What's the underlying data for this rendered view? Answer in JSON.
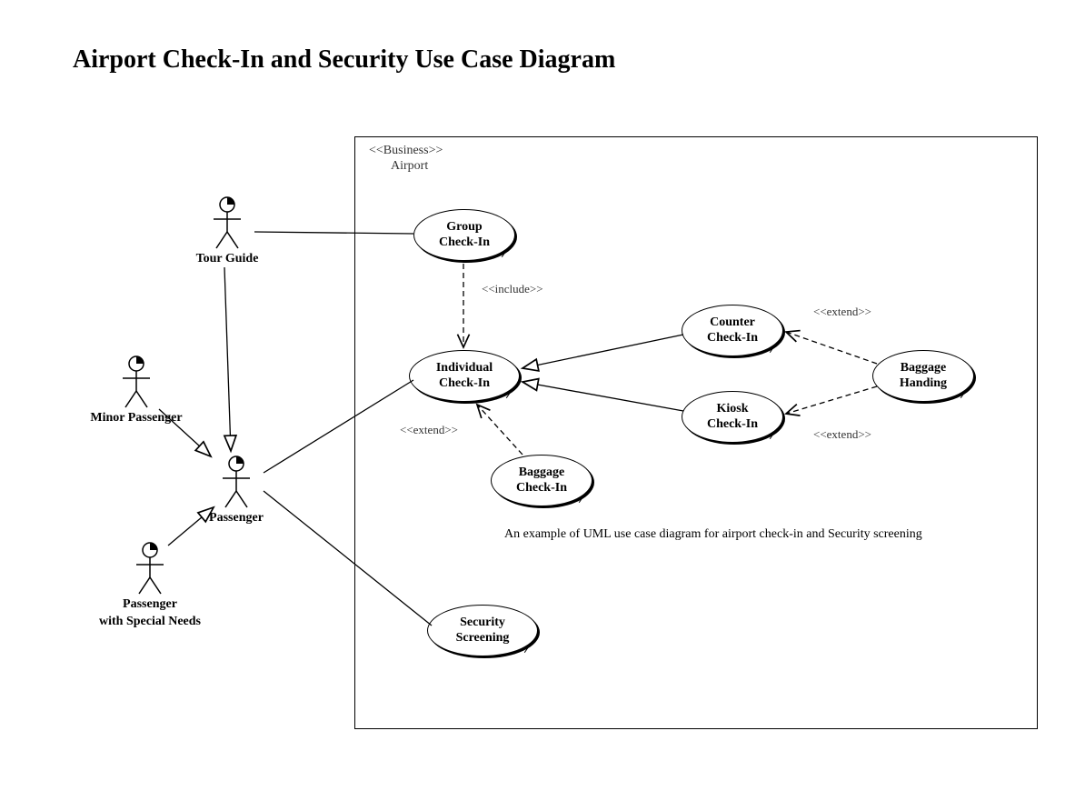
{
  "title": "Airport Check-In and Security Use Case Diagram",
  "system": {
    "stereotype": "<<Business>>",
    "name": "Airport"
  },
  "actors": {
    "tourGuide": "Tour Guide",
    "minorPassenger": "Minor Passenger",
    "passenger": "Passenger",
    "pwsn_line1": "Passenger",
    "pwsn_line2": "with Special Needs"
  },
  "usecases": {
    "groupCheckIn_l1": "Group",
    "groupCheckIn_l2": "Check-In",
    "individualCheckIn_l1": "Individual",
    "individualCheckIn_l2": "Check-In",
    "counterCheckIn_l1": "Counter",
    "counterCheckIn_l2": "Check-In",
    "kioskCheckIn_l1": "Kiosk",
    "kioskCheckIn_l2": "Check-In",
    "baggageHanding_l1": "Baggage",
    "baggageHanding_l2": "Handing",
    "baggageCheckIn_l1": "Baggage",
    "baggageCheckIn_l2": "Check-In",
    "securityScreening_l1": "Security",
    "securityScreening_l2": "Screening"
  },
  "rel": {
    "include": "<<include>>",
    "extend1": "<<extend>>",
    "extend2": "<<extend>>",
    "extend3": "<<extend>>"
  },
  "caption": "An example of UML use case diagram for airport check-in and Security screening"
}
